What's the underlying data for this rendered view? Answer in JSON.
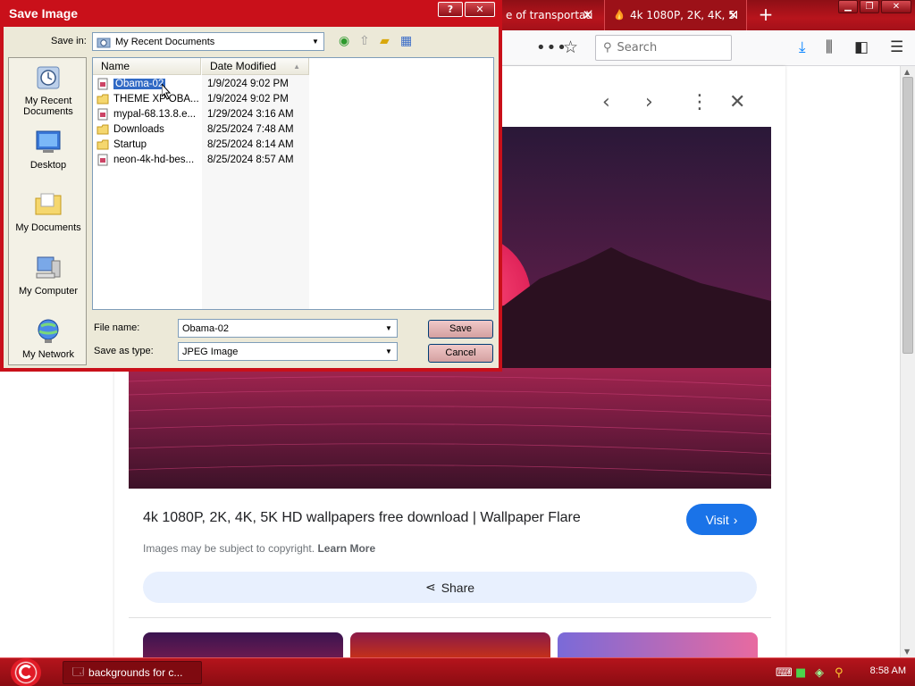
{
  "browser": {
    "tabs": [
      {
        "label": "e of transportati",
        "close": "✕"
      },
      {
        "label": "4k 1080P, 2K, 4K, 5K",
        "close": "✕"
      }
    ],
    "new_tab": "+",
    "search_placeholder": "Search"
  },
  "viewer": {
    "result_title": "4k 1080P, 2K, 4K, 5K HD wallpapers free download | Wallpaper Flare",
    "visit_label": "Visit",
    "copyright_text": "Images may be subject to copyright.",
    "learn_more": "Learn More",
    "share_label": "Share"
  },
  "dialog": {
    "title": "Save Image",
    "help": "?",
    "close": "✕",
    "save_in_label": "Save in:",
    "save_in_value": "My Recent Documents",
    "places": [
      {
        "label": "My Recent Documents"
      },
      {
        "label": "Desktop"
      },
      {
        "label": "My Documents"
      },
      {
        "label": "My Computer"
      },
      {
        "label": "My Network"
      }
    ],
    "columns": {
      "name": "Name",
      "date": "Date Modified"
    },
    "files": [
      {
        "name": "Obama-02",
        "date": "1/9/2024 9:02 PM",
        "type": "image"
      },
      {
        "name": "THEME XP OBA...",
        "date": "1/9/2024 9:02 PM",
        "type": "folder"
      },
      {
        "name": "mypal-68.13.8.e...",
        "date": "1/29/2024 3:16 AM",
        "type": "image"
      },
      {
        "name": "Downloads",
        "date": "8/25/2024 7:48 AM",
        "type": "folder"
      },
      {
        "name": "Startup",
        "date": "8/25/2024 8:14 AM",
        "type": "folder"
      },
      {
        "name": "neon-4k-hd-bes...",
        "date": "8/25/2024 8:57 AM",
        "type": "image"
      }
    ],
    "file_name_label": "File name:",
    "file_name_value": "Obama-02",
    "save_type_label": "Save as type:",
    "save_type_value": "JPEG Image",
    "save_button": "Save",
    "cancel_button": "Cancel"
  },
  "taskbar": {
    "task_label": "backgrounds for c...",
    "clock": "8:58 AM"
  },
  "colors": {
    "titlebar_red": "#b8141c",
    "visit_blue": "#1a73e8",
    "share_bg": "#e8f0fe",
    "selection": "#316ac5"
  }
}
